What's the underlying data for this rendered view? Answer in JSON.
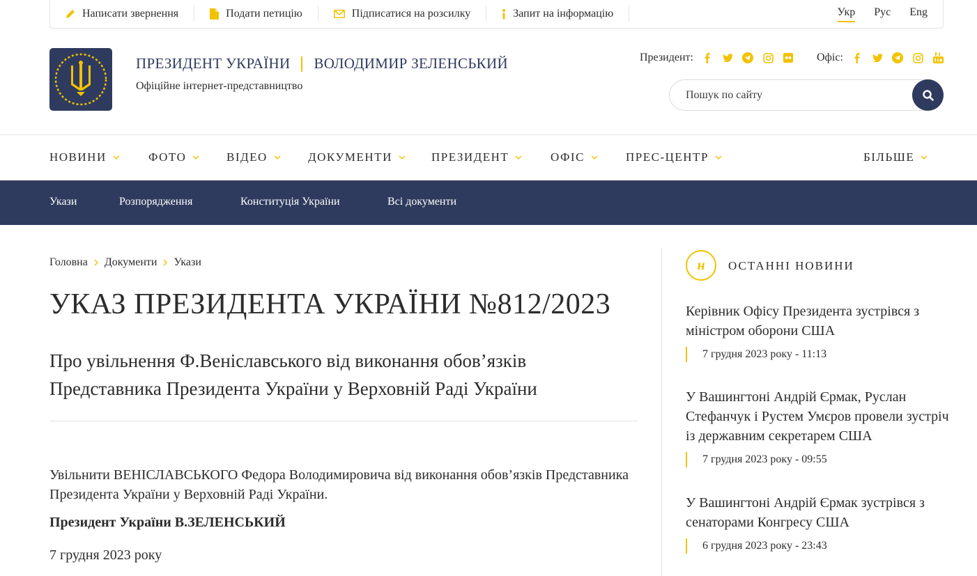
{
  "topbar": {
    "links": [
      {
        "label": "Написати звернення",
        "icon": "pencil-icon"
      },
      {
        "label": "Подати петицію",
        "icon": "document-icon"
      },
      {
        "label": "Підписатися на розсилку",
        "icon": "envelope-icon"
      },
      {
        "label": "Запит на інформацію",
        "icon": "info-icon"
      }
    ],
    "languages": [
      "Укр",
      "Рус",
      "Eng"
    ],
    "active_language": "Укр"
  },
  "header": {
    "title_left": "ПРЕЗИДЕНТ УКРАЇНИ",
    "title_right": "ВОЛОДИМИР ЗЕЛЕНСЬКИЙ",
    "subtitle": "Офіційне інтернет-представництво",
    "president_label": "Президент:",
    "office_label": "Офіс:",
    "president_socials": [
      "facebook-icon",
      "twitter-icon",
      "telegram-icon",
      "instagram-icon",
      "flickr-icon"
    ],
    "office_socials": [
      "facebook-icon",
      "twitter-icon",
      "telegram-icon",
      "instagram-icon",
      "youtube-icon"
    ],
    "search_placeholder": "Пошук по сайту"
  },
  "main_nav": [
    "НОВИНИ",
    "ФОТО",
    "ВІДЕО",
    "ДОКУМЕНТИ",
    "ПРЕЗИДЕНТ",
    "ОФІС",
    "ПРЕС-ЦЕНТР",
    "БІЛЬШЕ"
  ],
  "sub_nav": [
    "Укази",
    "Розпорядження",
    "Конституція України",
    "Всі документи"
  ],
  "breadcrumb": [
    "Головна",
    "Документи",
    "Укази"
  ],
  "document": {
    "title": "УКАЗ ПРЕЗИДЕНТА УКРАЇНИ №812/2023",
    "subtitle": "Про увільнення Ф.Веніславського від виконання обов’язків Представника Президента України у Верховній Раді України",
    "body": "Увільнити ВЕНІСЛАВСЬКОГО Федора Володимировича від виконання обов’язків Представника Президента України у Верховній Раді України.",
    "signature": "Президент України В.ЗЕЛЕНСЬКИЙ",
    "date": "7 грудня 2023 року"
  },
  "sidebar": {
    "badge": "н",
    "heading": "ОСТАННІ НОВИНИ",
    "news": [
      {
        "title": "Керівник Офісу Президента зустрівся з міністром оборони США",
        "date": "7 грудня 2023 року - 11:13"
      },
      {
        "title": "У Вашингтоні Андрій Єрмак, Руслан Стефанчук і Рустем Умєров провели зустріч із державним секретарем США",
        "date": "7 грудня 2023 року - 09:55"
      },
      {
        "title": "У Вашингтоні Андрій Єрмак зустрівся з сенаторами Конгресу США",
        "date": "6 грудня 2023 року - 23:43"
      }
    ]
  },
  "colors": {
    "accent": "#f2c200",
    "navy": "#2f3b5e",
    "text": "#2c2c2c"
  }
}
